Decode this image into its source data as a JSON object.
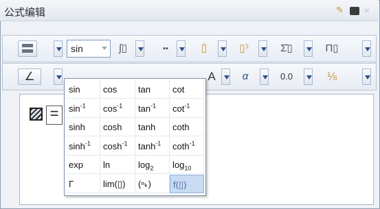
{
  "window": {
    "title": "公式编辑",
    "pin_icon": "pin-icon",
    "dock_icon": "dock-icon",
    "close_glyph": "×"
  },
  "toolbar1": {
    "func_combo_value": "sin",
    "integral_label": "∫▯",
    "matrix_label": "▪▪",
    "accent_label": "▯̇",
    "power_label": "▯ˀ",
    "sum_label": "Σ̂▯",
    "product_label": "Π▯"
  },
  "toolbar2": {
    "angle_label": "∠",
    "font_label": "A",
    "greek_label": "α",
    "number_label": "0.0",
    "fraction_label": "⅛"
  },
  "dropdown": {
    "rows": [
      [
        {
          "t": "sin"
        },
        {
          "t": "cos"
        },
        {
          "t": "tan"
        },
        {
          "t": "cot"
        }
      ],
      [
        {
          "t": "sin",
          "sup": "-1"
        },
        {
          "t": "cos",
          "sup": "-1"
        },
        {
          "t": "tan",
          "sup": "-1"
        },
        {
          "t": "cot",
          "sup": "-1"
        }
      ],
      [
        {
          "t": "sinh"
        },
        {
          "t": "cosh"
        },
        {
          "t": "tanh"
        },
        {
          "t": "coth"
        }
      ],
      [
        {
          "t": "sinh",
          "sup": "-1"
        },
        {
          "t": "cosh",
          "sup": "-1"
        },
        {
          "t": "tanh",
          "sup": "-1"
        },
        {
          "t": "coth",
          "sup": "-1"
        }
      ],
      [
        {
          "t": "exp"
        },
        {
          "t": "ln"
        },
        {
          "t": "log",
          "sub": "2"
        },
        {
          "t": "log",
          "sub": "10"
        }
      ],
      [
        {
          "t": "Γ"
        },
        {
          "t": "lim(▯)"
        },
        {
          "t": "(ⁿₖ)"
        },
        {
          "t": "f(▯)"
        }
      ]
    ],
    "selected": "f(▯)"
  },
  "colors": {
    "accent": "#2d4f86",
    "selected_bg": "#c8dbf3"
  }
}
